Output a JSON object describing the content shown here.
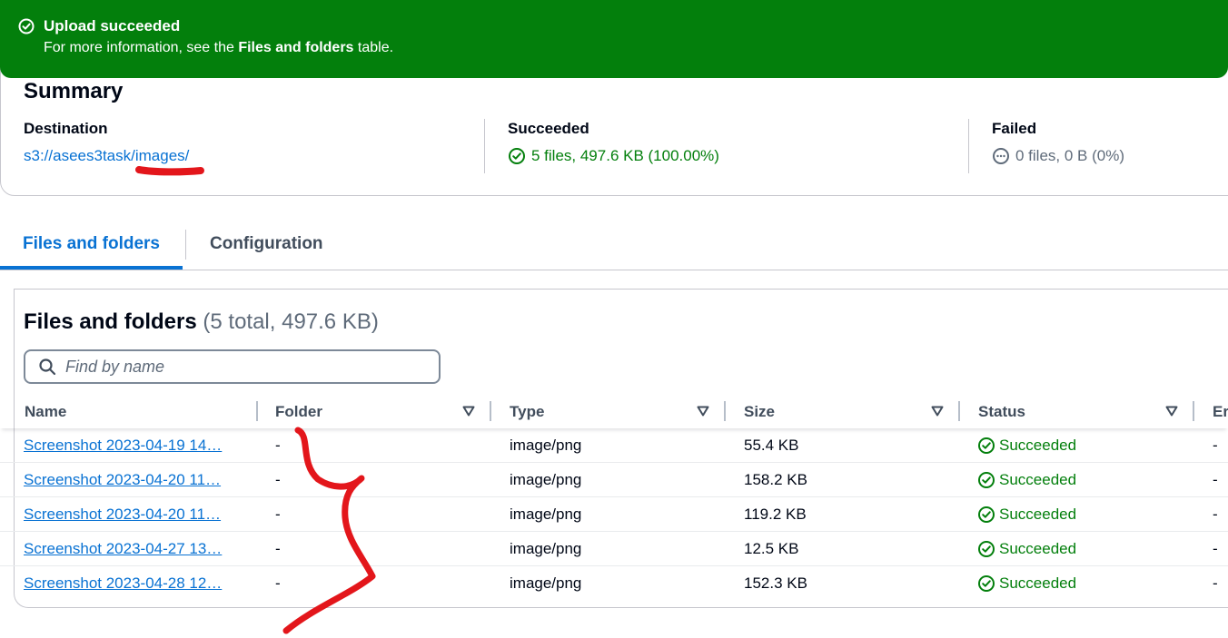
{
  "flash": {
    "title": "Upload succeeded",
    "message_prefix": "For more information, see the ",
    "message_bold": "Files and folders",
    "message_suffix": " table."
  },
  "summary": {
    "title": "Summary",
    "destination_label": "Destination",
    "destination_value": "s3://asees3task/images/",
    "succeeded_label": "Succeeded",
    "succeeded_value": "5 files, 497.6 KB (100.00%)",
    "failed_label": "Failed",
    "failed_value": "0 files, 0 B (0%)"
  },
  "tabs": [
    {
      "label": "Files and folders",
      "active": true
    },
    {
      "label": "Configuration",
      "active": false
    }
  ],
  "files_section": {
    "title": "Files and folders",
    "count": "(5 total, 497.6 KB)",
    "search_placeholder": "Find by name"
  },
  "table": {
    "columns": [
      "Name",
      "Folder",
      "Type",
      "Size",
      "Status",
      "Er"
    ],
    "rows": [
      {
        "name": "Screenshot 2023-04-19 14…",
        "folder": "-",
        "type": "image/png",
        "size": "55.4 KB",
        "status": "Succeeded",
        "error": "-"
      },
      {
        "name": "Screenshot 2023-04-20 11…",
        "folder": "-",
        "type": "image/png",
        "size": "158.2 KB",
        "status": "Succeeded",
        "error": "-"
      },
      {
        "name": "Screenshot 2023-04-20 11…",
        "folder": "-",
        "type": "image/png",
        "size": "119.2 KB",
        "status": "Succeeded",
        "error": "-"
      },
      {
        "name": "Screenshot 2023-04-27 13…",
        "folder": "-",
        "type": "image/png",
        "size": "12.5 KB",
        "status": "Succeeded",
        "error": "-"
      },
      {
        "name": "Screenshot 2023-04-28 12…",
        "folder": "-",
        "type": "image/png",
        "size": "152.3 KB",
        "status": "Succeeded",
        "error": "-"
      }
    ]
  },
  "colors": {
    "success_green": "#037f0c",
    "link_blue": "#0972d3",
    "annotation_red": "#e3161b"
  }
}
